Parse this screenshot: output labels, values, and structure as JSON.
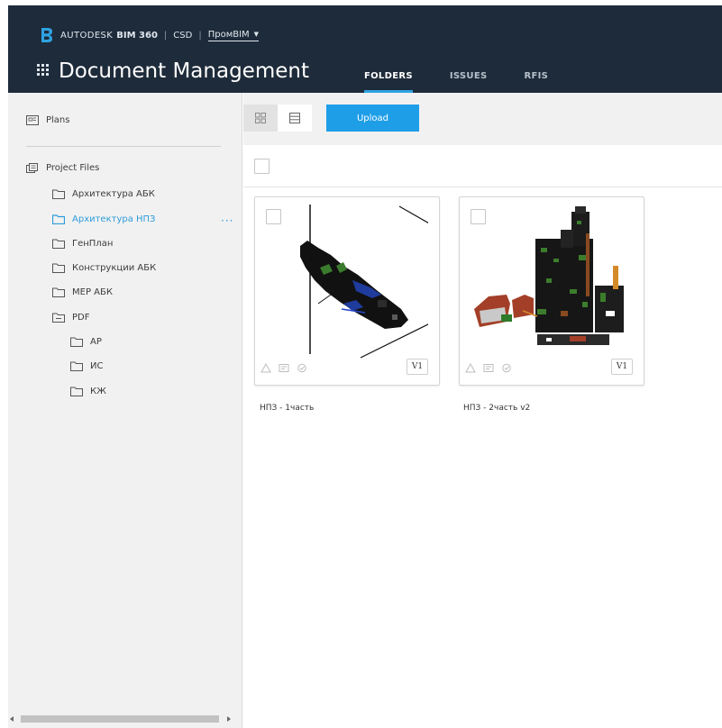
{
  "brand": {
    "vendor": "AUTODESK",
    "product": "BIM 360",
    "account": "CSD",
    "project": "ПромBIM"
  },
  "app": {
    "title": "Document Management",
    "tabs": [
      {
        "label": "FOLDERS",
        "active": true
      },
      {
        "label": "ISSUES",
        "active": false
      },
      {
        "label": "RFIS",
        "active": false
      }
    ]
  },
  "sidebar": {
    "plans_label": "Plans",
    "project_files_label": "Project Files",
    "folders": [
      {
        "label": "Архитектура АБК",
        "selected": false
      },
      {
        "label": "Архитектура НПЗ",
        "selected": true
      },
      {
        "label": "ГенПлан",
        "selected": false
      },
      {
        "label": "Конструкции АБК",
        "selected": false
      },
      {
        "label": "MEP АБК",
        "selected": false
      },
      {
        "label": "PDF",
        "selected": false
      }
    ],
    "subfolders": [
      {
        "label": "АР"
      },
      {
        "label": "ИС"
      },
      {
        "label": "КЖ"
      }
    ],
    "more_label": "···"
  },
  "toolbar": {
    "upload_label": "Upload"
  },
  "files": [
    {
      "name": "НПЗ - 1часть",
      "version": "V1"
    },
    {
      "name": "НПЗ - 2часть v2",
      "version": "V1"
    }
  ],
  "colors": {
    "header_bg": "#1e2b3a",
    "accent": "#2d9cdb",
    "upload_bg": "#1f9ee8"
  }
}
